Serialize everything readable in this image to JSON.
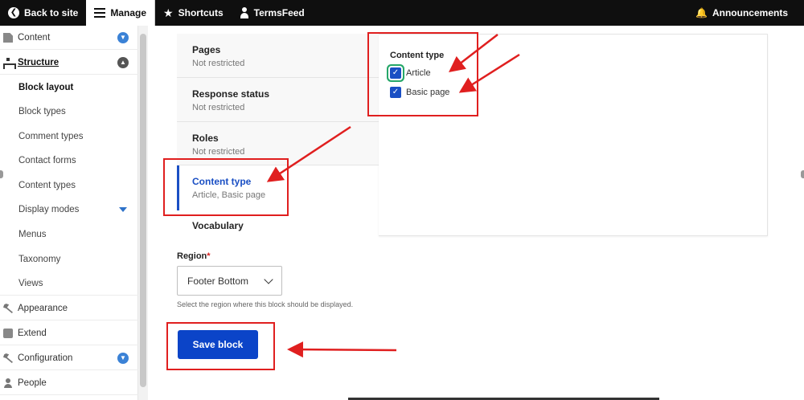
{
  "toolbar": {
    "back_to_site": "Back to site",
    "manage": "Manage",
    "shortcuts": "Shortcuts",
    "user": "TermsFeed",
    "announcements": "Announcements"
  },
  "sidebar": {
    "items": [
      {
        "label": "Content"
      },
      {
        "label": "Structure"
      },
      {
        "label": "Block layout"
      },
      {
        "label": "Block types"
      },
      {
        "label": "Comment types"
      },
      {
        "label": "Contact forms"
      },
      {
        "label": "Content types"
      },
      {
        "label": "Display modes"
      },
      {
        "label": "Menus"
      },
      {
        "label": "Taxonomy"
      },
      {
        "label": "Views"
      },
      {
        "label": "Appearance"
      },
      {
        "label": "Extend"
      },
      {
        "label": "Configuration"
      },
      {
        "label": "People"
      }
    ]
  },
  "tabs": [
    {
      "title": "Pages",
      "summary": "Not restricted"
    },
    {
      "title": "Response status",
      "summary": "Not restricted"
    },
    {
      "title": "Roles",
      "summary": "Not restricted"
    },
    {
      "title": "Content type",
      "summary": "Article, Basic page"
    },
    {
      "title": "Vocabulary",
      "summary": ""
    }
  ],
  "panel": {
    "title": "Content type",
    "options": [
      {
        "label": "Article",
        "checked": true
      },
      {
        "label": "Basic page",
        "checked": true
      }
    ]
  },
  "region": {
    "label": "Region",
    "required_mark": "*",
    "value": "Footer Bottom",
    "help": "Select the region where this block should be displayed."
  },
  "save_button": "Save block",
  "colors": {
    "accent": "#0b44c8",
    "annotation": "#e01f1f",
    "toolbar": "#0f0f0f"
  }
}
